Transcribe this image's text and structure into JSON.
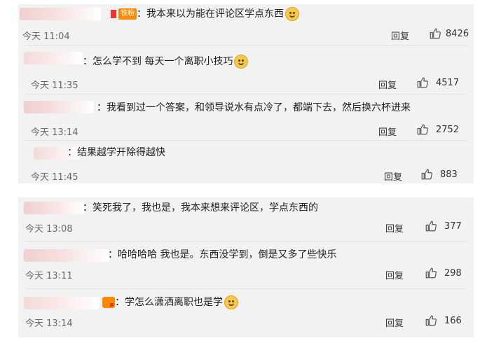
{
  "thread_a": {
    "main": {
      "fan_badge": "铁粉",
      "text": "：我本来以为能在评论区学点东西",
      "time": "今天 11:04",
      "reply_label": "回复",
      "likes": "8426"
    },
    "replies": [
      {
        "text": "：怎么学不到 每天一个离职小技巧",
        "time": "今天 11:35",
        "reply_label": "回复",
        "likes": "4517",
        "emoji": true
      },
      {
        "text": "：我看到过一个答案，和领导说水有点冷了，都端下去，然后换六杯进来",
        "time": "今天 13:14",
        "reply_label": "回复",
        "likes": "2752",
        "emoji": false
      },
      {
        "text": "：结果越学开除得越快",
        "time": "今天 11:45",
        "reply_label": "回复",
        "likes": "883",
        "emoji": false
      }
    ]
  },
  "thread_b": {
    "items": [
      {
        "text": "：笑死我了，我也是，我本来想来评论区，学点东西的",
        "time": "今天 13:08",
        "reply_label": "回复",
        "likes": "377"
      },
      {
        "text": "：哈哈哈哈 我也是。东西没学到，倒是又多了些快乐",
        "time": "今天 13:11",
        "reply_label": "回复",
        "likes": "298"
      },
      {
        "text": "：学怎么潇洒离职也是学",
        "time": "今天 13:14",
        "reply_label": "回复",
        "likes": "166"
      }
    ]
  },
  "icons": {
    "like": "thumbs-up-icon",
    "emoji": "doge-emoji-icon",
    "badge": "fan-badge-icon"
  },
  "colors": {
    "panel_bg": "#f2f2f2",
    "badge": "#ff8a00",
    "text": "#222222",
    "meta": "#6a6a6a"
  }
}
